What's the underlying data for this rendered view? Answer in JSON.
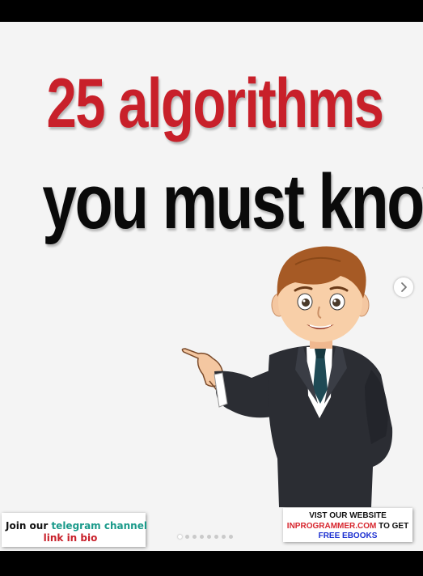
{
  "headline": {
    "line1": "25 algorithms",
    "line2": "you must know"
  },
  "colors": {
    "title_red": "#c8202a",
    "title_black": "#0a0a0a",
    "telegram_teal": "#1a9a8a",
    "website_red": "#d7262e",
    "ebooks_blue": "#1b2fd1",
    "background": "#f4f4f4"
  },
  "join_banner": {
    "prefix": "Join our",
    "highlight": "telegram channel",
    "line2": "link in bio"
  },
  "visit_banner": {
    "line1": "VIST OUR WEBSITE",
    "site": "INPROGRAMMER.COM",
    "suffix": "TO GET",
    "line3": "FREE EBOOKS"
  },
  "carousel": {
    "next_icon": "chevron-right-icon",
    "total_slides": 8,
    "active_slide": 1
  },
  "illustration": "businessman-pointing-illustration"
}
